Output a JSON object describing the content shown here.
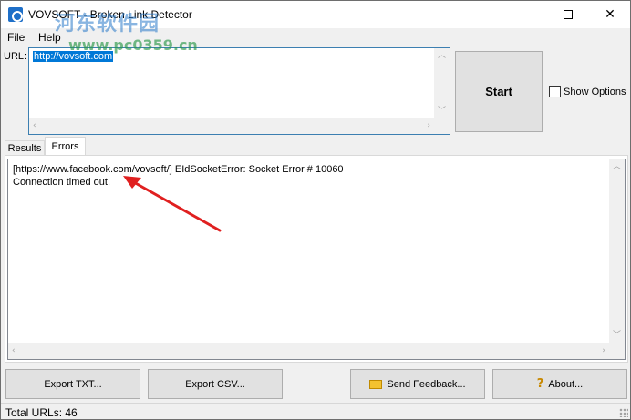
{
  "window": {
    "title": "VOVSOFT - Broken Link Detector",
    "minimize_icon": "minimize-icon",
    "maximize_icon": "maximize-icon",
    "close_glyph": "✕"
  },
  "watermark": {
    "text": "河东软件园",
    "url": "www.pc0359.cn"
  },
  "menu": {
    "file": "File",
    "help": "Help"
  },
  "url": {
    "label": "URL:",
    "value": "http://vovsoft.com"
  },
  "controls": {
    "start_label": "Start",
    "show_options_label": "Show Options",
    "show_options_checked": false
  },
  "tabs": [
    {
      "label": "Results",
      "active": false
    },
    {
      "label": "Errors",
      "active": true
    }
  ],
  "errors_log": {
    "lines": [
      "[https://www.facebook.com/vovsoft/] EIdSocketError: Socket Error # 10060",
      "Connection timed out."
    ]
  },
  "annotation": {
    "arrow_color": "#e02020"
  },
  "buttons": {
    "export_txt": "Export TXT...",
    "export_csv": "Export CSV...",
    "send_feedback": "Send Feedback...",
    "about": "About..."
  },
  "status": {
    "text": "Total URLs: 46"
  }
}
